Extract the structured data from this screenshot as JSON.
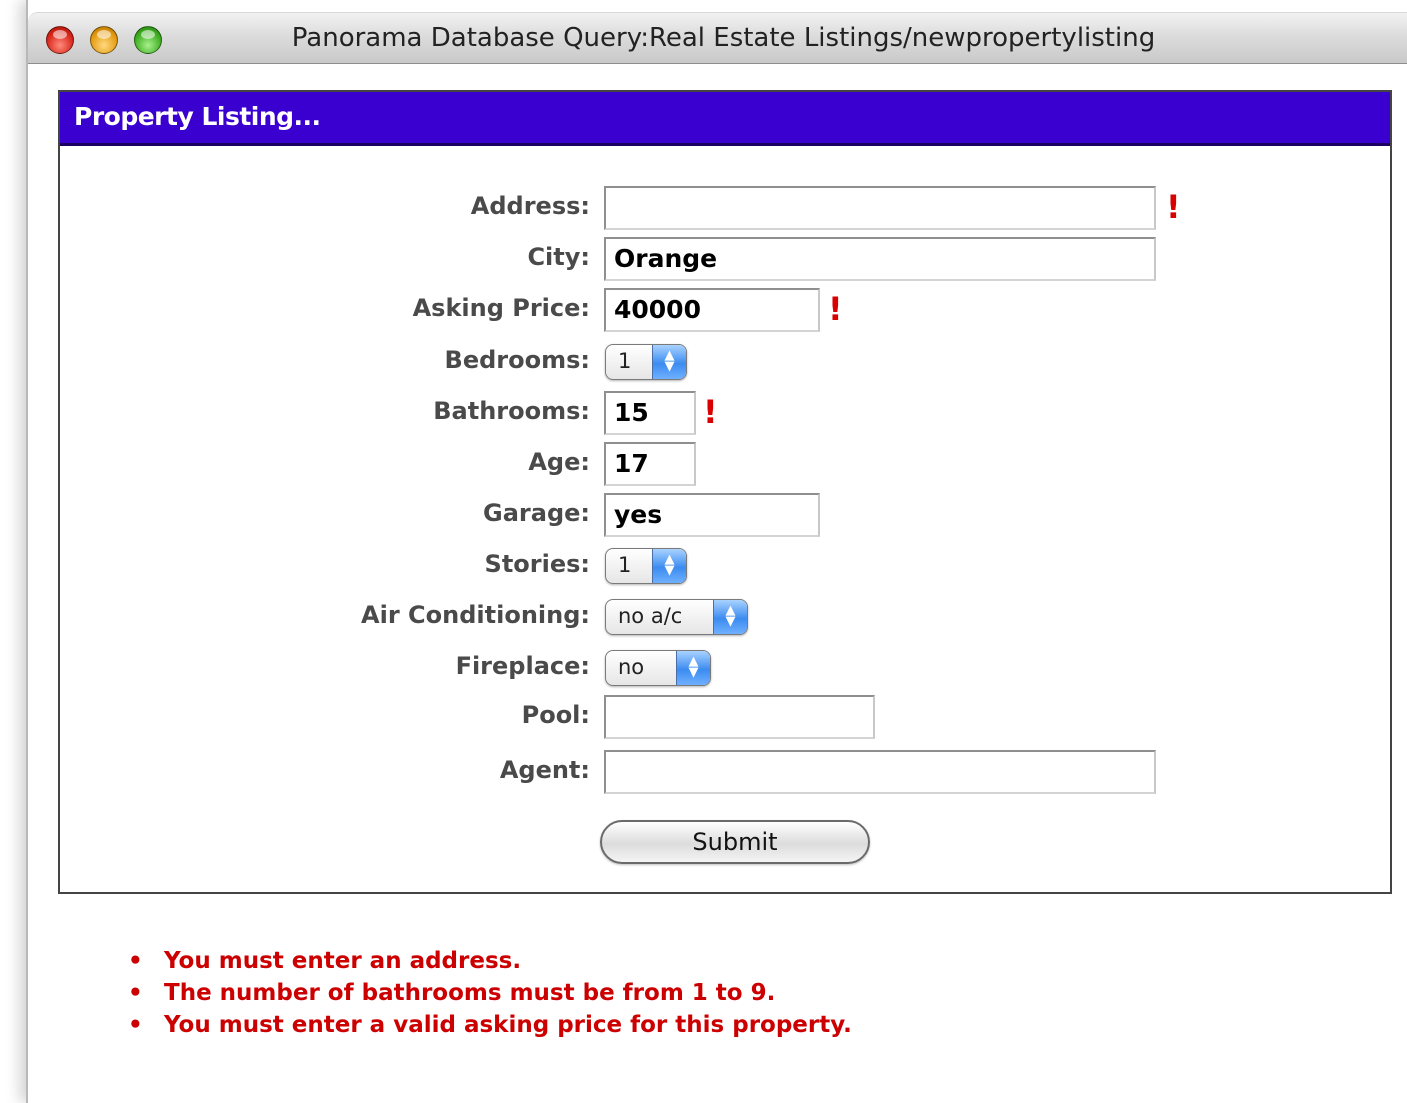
{
  "window": {
    "title": "Panorama Database Query:Real Estate Listings/newpropertylisting"
  },
  "panel": {
    "header": "Property Listing..."
  },
  "form": {
    "address": {
      "label": "Address:",
      "value": "",
      "error_mark": "!"
    },
    "city": {
      "label": "City:",
      "value": "Orange"
    },
    "asking_price": {
      "label": "Asking Price:",
      "value": "40000",
      "error_mark": "!"
    },
    "bedrooms": {
      "label": "Bedrooms:",
      "selected": "1"
    },
    "bathrooms": {
      "label": "Bathrooms:",
      "value": "15",
      "error_mark": "!"
    },
    "age": {
      "label": "Age:",
      "value": "17"
    },
    "garage": {
      "label": "Garage:",
      "value": "yes"
    },
    "stories": {
      "label": "Stories:",
      "selected": "1"
    },
    "air_conditioning": {
      "label": "Air Conditioning:",
      "selected": "no a/c"
    },
    "fireplace": {
      "label": "Fireplace:",
      "selected": "no"
    },
    "pool": {
      "label": "Pool:",
      "value": ""
    },
    "agent": {
      "label": "Agent:",
      "value": ""
    },
    "submit_label": "Submit"
  },
  "errors": [
    "You must enter an address.",
    "The number of bathrooms must be from 1 to 9.",
    "You must enter a valid asking price for this property."
  ],
  "colors": {
    "header_bg": "#3a00d0",
    "error_text": "#cc0000"
  }
}
